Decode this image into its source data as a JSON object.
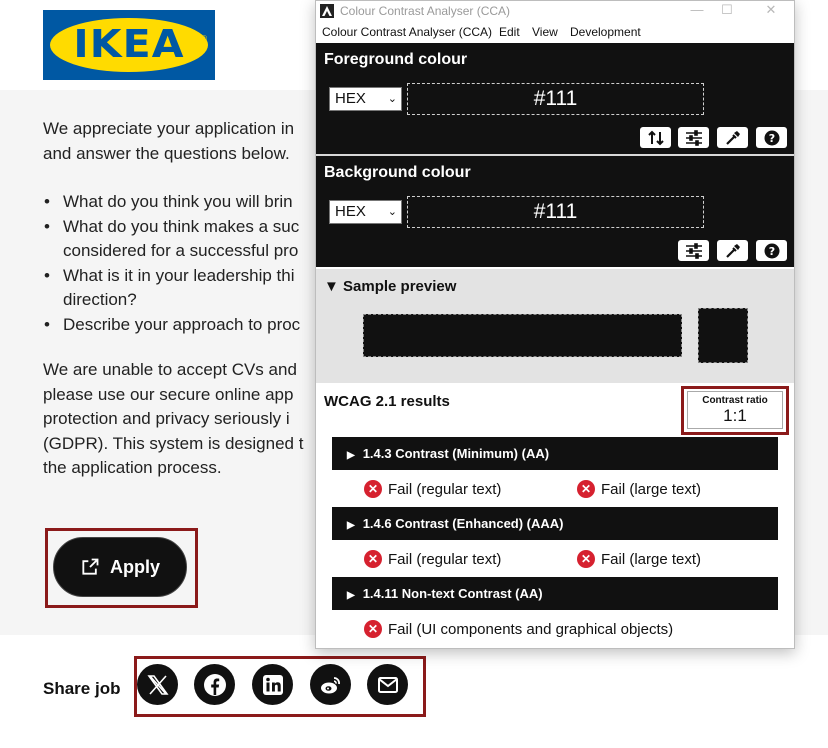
{
  "page": {
    "logo_text": "IKEA",
    "logo_reg": "®",
    "intro_lines": [
      "We appreciate your application in",
      "and answer the questions below."
    ],
    "bullets": [
      [
        "What do you think you will brin"
      ],
      [
        "What do you think makes a suc",
        "considered for a successful pro"
      ],
      [
        "What is it in your leadership thi",
        "direction?"
      ],
      [
        "Describe your approach to proc"
      ]
    ],
    "para2_lines": [
      "We are unable to accept CVs and",
      "please use our secure online app",
      "protection and privacy seriously i",
      "(GDPR). This system is designed t",
      "the application process."
    ],
    "apply_label": "Apply",
    "share_label": "Share job",
    "social_icons": [
      "x-icon",
      "facebook-icon",
      "linkedin-icon",
      "weibo-icon",
      "email-icon"
    ]
  },
  "cca": {
    "title": "Colour Contrast Analyser (CCA)",
    "menu": [
      "Colour Contrast Analyser (CCA)",
      "Edit",
      "View",
      "Development"
    ],
    "window_controls": {
      "minimize": "—",
      "maximize": "☐",
      "close": "✕"
    },
    "foreground": {
      "heading": "Foreground colour",
      "format": "HEX",
      "value": "#111"
    },
    "background": {
      "heading": "Background colour",
      "format": "HEX",
      "value": "#111"
    },
    "sample": {
      "heading": "Sample preview",
      "triangle": "▼"
    },
    "results": {
      "heading": "WCAG 2.1 results",
      "contrast_label": "Contrast ratio",
      "contrast_value": "1:1",
      "criteria": [
        {
          "title": "1.4.3 Contrast (Minimum) (AA)",
          "fails": [
            "Fail (regular text)",
            "Fail (large text)"
          ]
        },
        {
          "title": "1.4.6 Contrast (Enhanced) (AAA)",
          "fails": [
            "Fail (regular text)",
            "Fail (large text)"
          ]
        },
        {
          "title": "1.4.11 Non-text Contrast (AA)",
          "fails": [
            "Fail (UI components and graphical objects)"
          ]
        }
      ]
    },
    "colors": {
      "panel": "#111111",
      "fail": "#d6212f",
      "highlight": "#8b1a1a"
    }
  }
}
